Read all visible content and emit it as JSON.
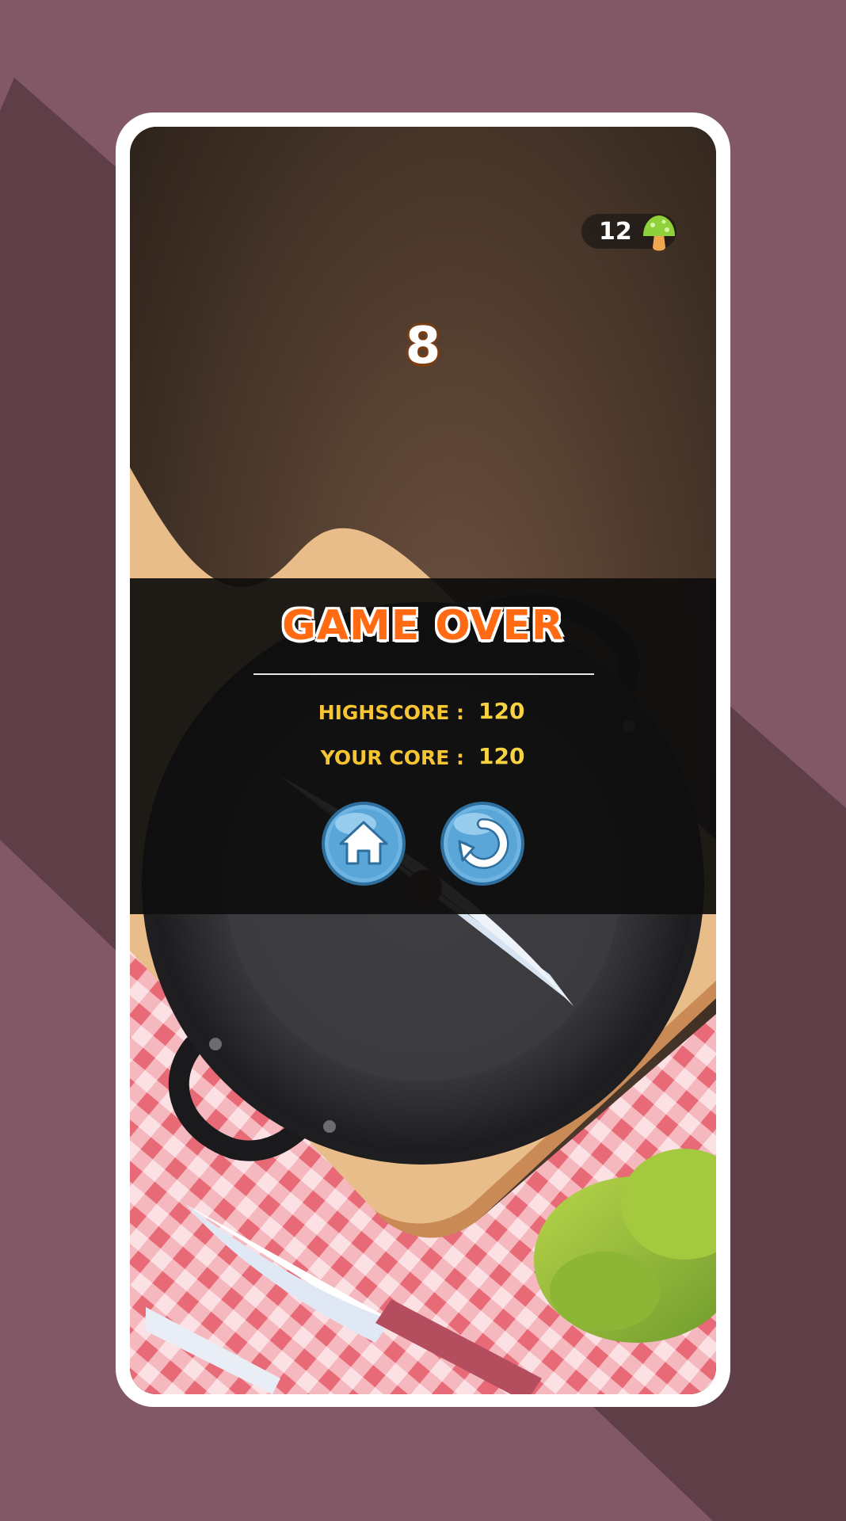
{
  "hud": {
    "coins": "12",
    "coin_icon": "green-mushroom-icon",
    "current_score": "8"
  },
  "game_over": {
    "title": "GAME OVER",
    "highscore_label": "HIGHSCORE :",
    "highscore_value": "120",
    "your_score_label": "YOUR CORE :",
    "your_score_value": "120"
  },
  "buttons": {
    "home_icon": "home-icon",
    "restart_icon": "restart-icon"
  },
  "colors": {
    "background": "#835866",
    "title": "#ff6a12",
    "stat_text": "#f7c531",
    "button_blue": "#5aa6d8"
  }
}
